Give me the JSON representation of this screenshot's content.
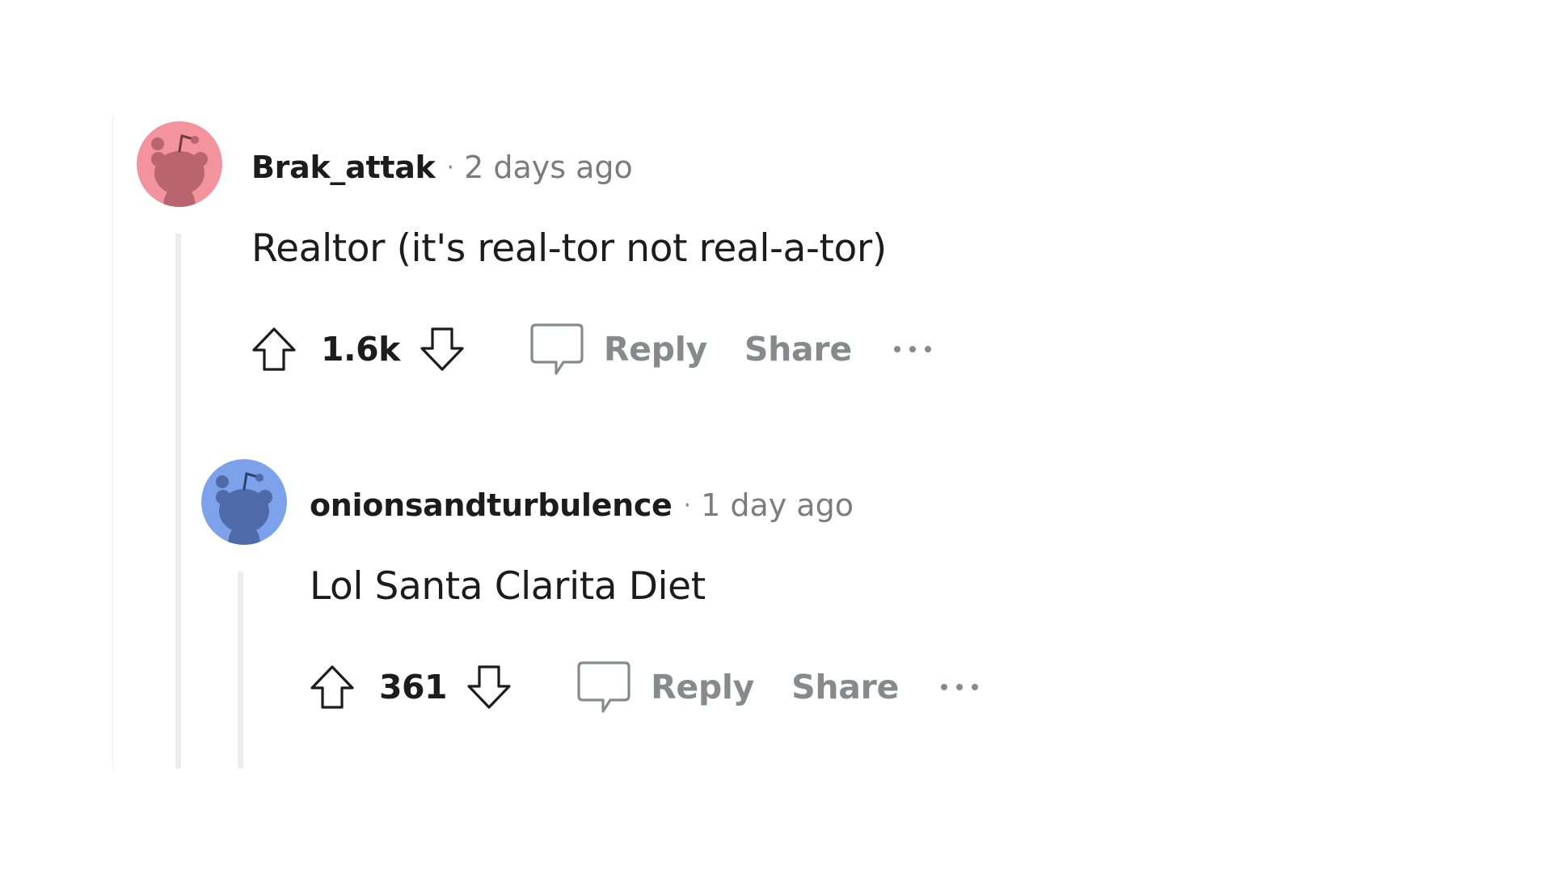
{
  "colors": {
    "author_text": "#1c1c1c",
    "meta_text": "#7c7c7c",
    "action_text": "#878a8c",
    "thread_line": "#ededed",
    "avatar_pink": "#f3939d",
    "avatar_blue": "#7da1ea"
  },
  "comments": [
    {
      "author": "Brak_attak",
      "separator": "·",
      "time": "2 days ago",
      "text": "Realtor (it's real-tor not real-a-tor)",
      "score": "1.6k",
      "reply_label": "Reply",
      "share_label": "Share",
      "avatar_icon": "snoo-avatar-pink",
      "icons": [
        "upvote-arrow-icon",
        "downvote-arrow-icon",
        "comment-bubble-icon",
        "more-options-icon"
      ]
    },
    {
      "author": "onionsandturbulence",
      "separator": "·",
      "time": "1 day ago",
      "text": "Lol Santa Clarita Diet",
      "score": "361",
      "reply_label": "Reply",
      "share_label": "Share",
      "avatar_icon": "snoo-avatar-blue",
      "icons": [
        "upvote-arrow-icon",
        "downvote-arrow-icon",
        "comment-bubble-icon",
        "more-options-icon"
      ]
    }
  ]
}
